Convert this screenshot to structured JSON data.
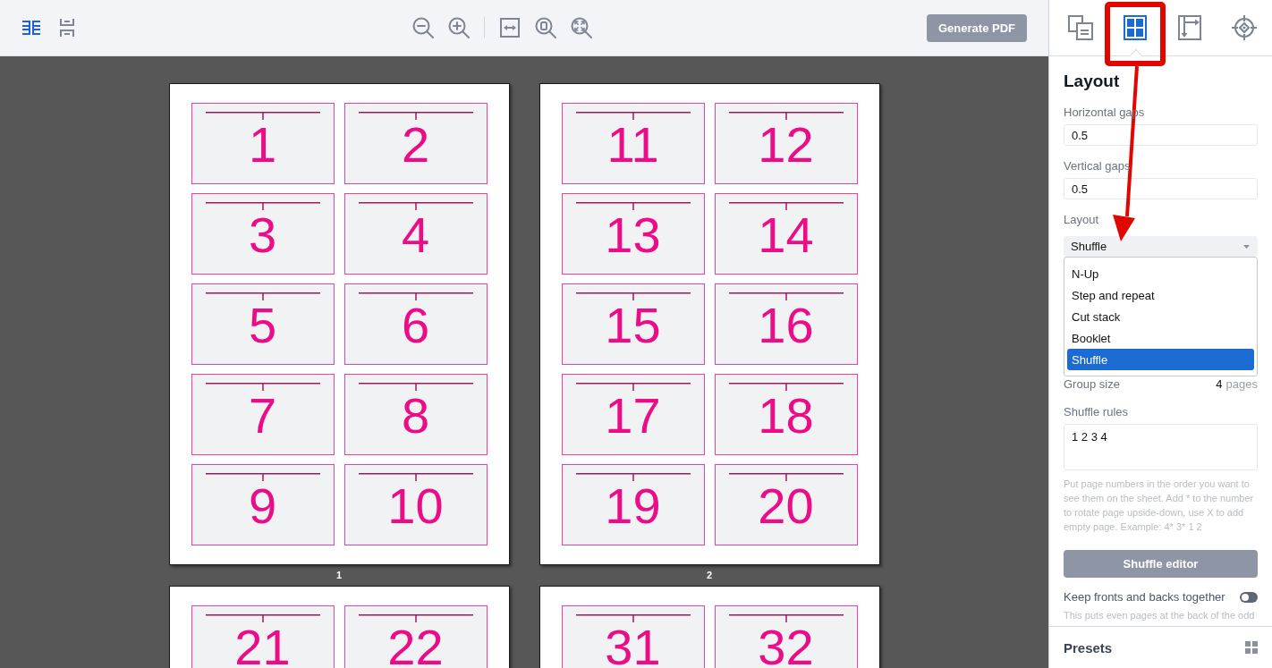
{
  "toolbar": {
    "view_modes": [
      {
        "kind": "side-by-side",
        "selected": true
      },
      {
        "kind": "stacked",
        "selected": false
      }
    ],
    "generate_button": "Generate PDF"
  },
  "sheets": [
    {
      "label": "1",
      "cells": [
        "1",
        "2",
        "3",
        "4",
        "5",
        "6",
        "7",
        "8",
        "9",
        "10"
      ]
    },
    {
      "label": "2",
      "cells": [
        "11",
        "12",
        "13",
        "14",
        "15",
        "16",
        "17",
        "18",
        "19",
        "20"
      ]
    },
    {
      "cells": [
        "21",
        "22"
      ]
    },
    {
      "cells": [
        "31",
        "32"
      ]
    }
  ],
  "sidebar": {
    "tabs": [
      {
        "kind": "copies",
        "selected": false
      },
      {
        "kind": "layout",
        "selected": true
      },
      {
        "kind": "margins",
        "selected": false
      },
      {
        "kind": "marks",
        "selected": false
      }
    ],
    "title": "Layout",
    "horizontal_gaps": {
      "label": "Horizontal gaps",
      "value": "0.5"
    },
    "vertical_gaps": {
      "label": "Vertical gaps",
      "value": "0.5"
    },
    "layout_select": {
      "label": "Layout",
      "value": "Shuffle",
      "expanded": true,
      "options": [
        {
          "label": "N-Up",
          "selected": false
        },
        {
          "label": "Step and repeat",
          "selected": false
        },
        {
          "label": "Cut stack",
          "selected": false
        },
        {
          "label": "Booklet",
          "selected": false
        },
        {
          "label": "Shuffle",
          "selected": true
        }
      ]
    },
    "group_size": {
      "label": "Group size",
      "value": "4",
      "unit": "pages"
    },
    "shuffle_rules": {
      "label": "Shuffle rules",
      "value": "1 2 3 4",
      "hint": "Put page numbers in the order you want to see them on the sheet. Add * to the number to rotate page upside-down, use X to add empty page. Example: 4* 3* 1 2"
    },
    "shuffle_editor_button": "Shuffle editor",
    "keep_together": {
      "label": "Keep fronts and backs together",
      "on": false,
      "description": "This puts even pages at the back of the odd"
    },
    "presets": {
      "title": "Presets"
    }
  }
}
